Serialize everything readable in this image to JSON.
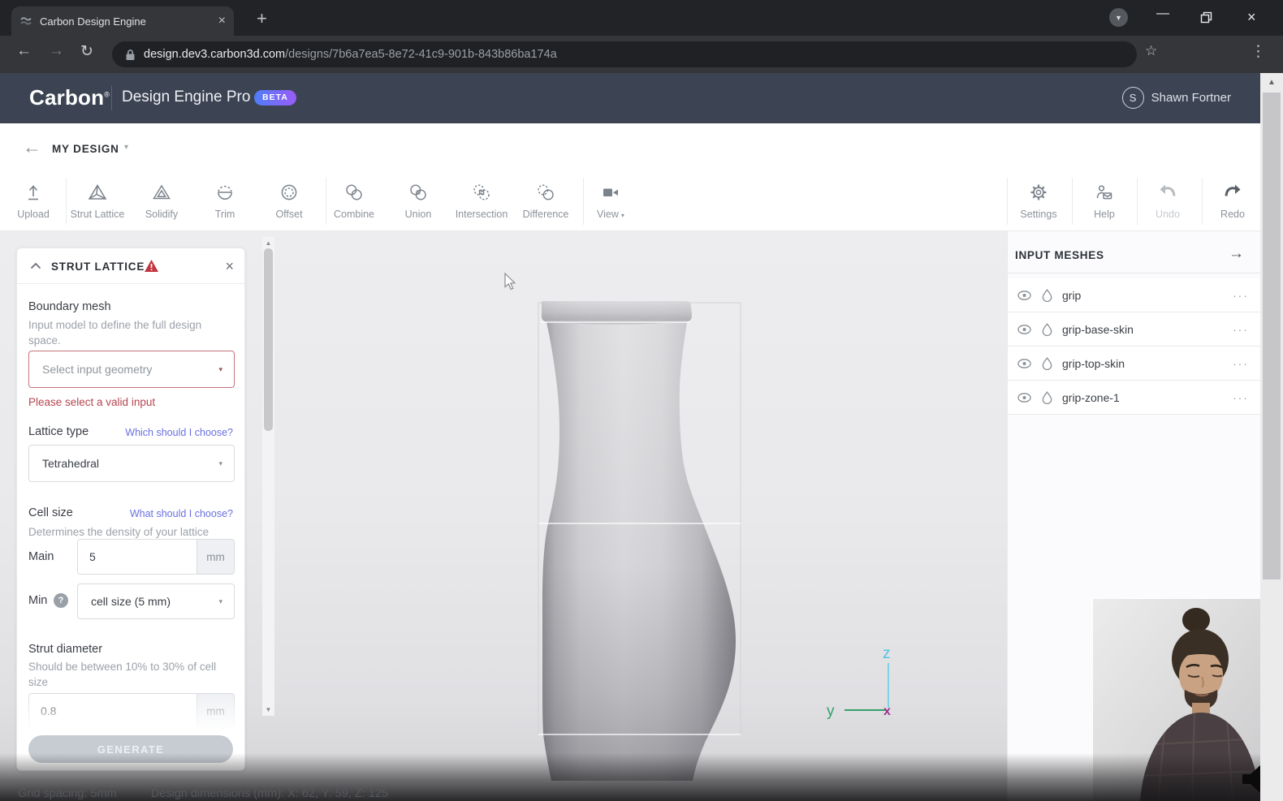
{
  "browser": {
    "tab_title": "Carbon Design Engine",
    "url": {
      "domain": "design.dev3.carbon3d.com",
      "path": "/designs/7b6a7ea5-8e72-41c9-901b-843b86ba174a"
    }
  },
  "header": {
    "brand": "Carbon",
    "registered": "®",
    "product": "Design Engine Pro",
    "beta": "BETA",
    "user_initial": "S",
    "user_name": "Shawn Fortner"
  },
  "breadcrumb": {
    "title": "MY DESIGN"
  },
  "toolbar": {
    "items": [
      {
        "label": "Upload"
      },
      {
        "label": "Strut Lattice"
      },
      {
        "label": "Solidify"
      },
      {
        "label": "Trim"
      },
      {
        "label": "Offset"
      },
      {
        "label": "Combine"
      },
      {
        "label": "Union"
      },
      {
        "label": "Intersection"
      },
      {
        "label": "Difference"
      },
      {
        "label": "View"
      }
    ],
    "right_items": [
      {
        "label": "Settings"
      },
      {
        "label": "Help"
      },
      {
        "label": "Undo"
      },
      {
        "label": "Redo"
      }
    ]
  },
  "panel": {
    "title": "STRUT LATTICE",
    "boundary": {
      "label": "Boundary mesh",
      "description": "Input model to define the full design space.",
      "select_placeholder": "Select input geometry",
      "error": "Please select a valid input"
    },
    "lattice_type": {
      "label": "Lattice type",
      "help_link": "Which should I choose?",
      "value": "Tetrahedral"
    },
    "cell_size": {
      "label": "Cell size",
      "help_link": "What should I choose?",
      "description": "Determines the density of your lattice",
      "main_label": "Main",
      "main_value": "5",
      "main_unit": "mm",
      "min_label": "Min",
      "min_help": "?",
      "min_value": "cell size (5 mm)"
    },
    "strut_diameter": {
      "label": "Strut diameter",
      "description": "Should be between 10% to 30% of cell size",
      "value": "0.8",
      "unit": "mm"
    },
    "generate_label": "GENERATE"
  },
  "meshes": {
    "title": "INPUT MESHES",
    "items": [
      {
        "name": "grip"
      },
      {
        "name": "grip-base-skin"
      },
      {
        "name": "grip-top-skin"
      },
      {
        "name": "grip-zone-1"
      }
    ]
  },
  "axis": {
    "x": "x",
    "y": "y",
    "z": "z"
  },
  "status": {
    "grid": "Grid spacing: 5mm",
    "dimensions": "Design dimensions (mm): X: 62, Y: 59, Z: 125"
  },
  "colors": {
    "accent_link": "#6a6fe0",
    "error": "#b5454f",
    "beta_from": "#4f7df9",
    "beta_to": "#9a5cf6",
    "axis_z": "#4cc3e0",
    "axis_y": "#35a06b",
    "axis_x": "#a03090"
  },
  "icons": {
    "close": "×",
    "plus": "+",
    "minimize": "—",
    "menu_kebab": "⋮",
    "star": "☆",
    "back": "←",
    "forward": "→",
    "reload": "↻",
    "caret_down": "▾",
    "scroll_up": "▲",
    "scroll_down": "▼",
    "ellipsis": "···",
    "arrow_right": "→",
    "media_caret": "▼"
  }
}
